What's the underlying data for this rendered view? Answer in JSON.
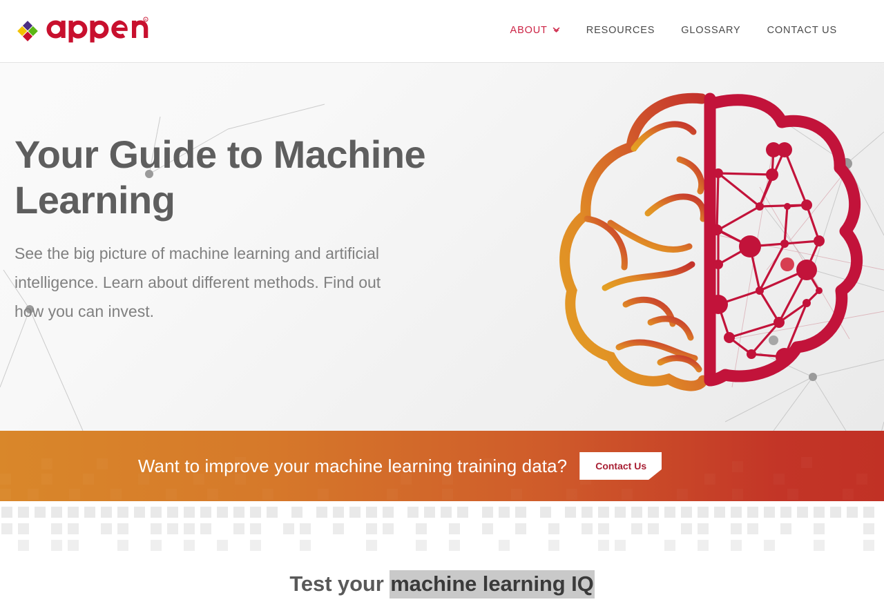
{
  "brand": {
    "name": "appen",
    "trademark": "®",
    "logo_colors": {
      "wordmark": "#c8102e",
      "diamond_top": "#4b2e83",
      "diamond_left": "#f2c200",
      "diamond_right": "#5cb615",
      "diamond_bottom": "#c8102e"
    }
  },
  "nav": {
    "items": [
      {
        "label": "ABOUT",
        "active": true,
        "has_dropdown": true,
        "icon": "chevron-down-icon"
      },
      {
        "label": "RESOURCES",
        "active": false,
        "has_dropdown": false
      },
      {
        "label": "GLOSSARY",
        "active": false,
        "has_dropdown": false
      },
      {
        "label": "CONTACT US",
        "active": false,
        "has_dropdown": false
      }
    ]
  },
  "hero": {
    "title": "Your Guide to Machine Learning",
    "subtitle": "See the big picture of machine learning and artificial intelligence. Learn about different methods. Find out how you can invest.",
    "graphic": "brain-hemispheres-illustration",
    "graphic_colors": {
      "left_gradient_start": "#e8a02b",
      "left_gradient_end": "#c93c2b",
      "right_network": "#c2133a",
      "background_nodes": "#9a9a9a"
    }
  },
  "cta": {
    "text": "Want to improve your machine learning training data?",
    "button_label": "Contact Us",
    "gradient_start": "#d9872a",
    "gradient_end": "#c13125"
  },
  "quiz": {
    "title_prefix": "Test your ",
    "title_selected": "machine learning IQ",
    "selection_highlight": "#c9c9c9"
  }
}
